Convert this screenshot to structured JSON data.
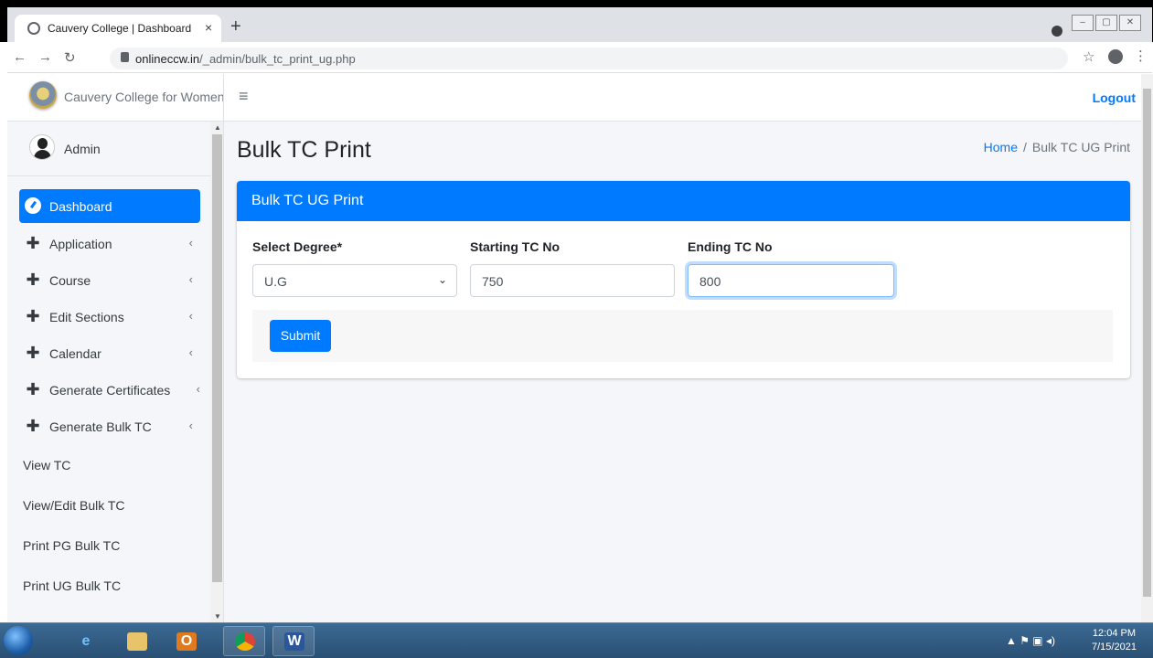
{
  "browser": {
    "tab_title": "Cauvery College | Dashboard",
    "tab_close": "×",
    "new_tab": "+",
    "url_host": "onlineccw.in",
    "url_path": "/_admin/bulk_tc_print_ug.php"
  },
  "sidebar": {
    "brand": "Cauvery College for Women",
    "user": "Admin",
    "items": [
      {
        "label": "Dashboard",
        "icon": "dashboard-gauge-icon",
        "active": true
      },
      {
        "label": "Application",
        "icon": "plus-icon",
        "chevron": "‹"
      },
      {
        "label": "Course",
        "icon": "plus-icon",
        "chevron": "‹"
      },
      {
        "label": "Edit Sections",
        "icon": "plus-icon",
        "chevron": "‹"
      },
      {
        "label": "Calendar",
        "icon": "plus-icon",
        "chevron": "‹"
      },
      {
        "label": "Generate Certificates",
        "icon": "plus-icon",
        "chevron": "‹"
      },
      {
        "label": "Generate Bulk TC",
        "icon": "plus-icon",
        "chevron": "‹"
      },
      {
        "label": "View TC"
      },
      {
        "label": "View/Edit Bulk TC"
      },
      {
        "label": "Print PG Bulk TC"
      },
      {
        "label": "Print UG Bulk TC"
      }
    ]
  },
  "header": {
    "logout": "Logout"
  },
  "page": {
    "title": "Bulk TC Print",
    "breadcrumb_home": "Home",
    "breadcrumb_sep": "/",
    "breadcrumb_current": "Bulk TC UG Print"
  },
  "form": {
    "card_title": "Bulk TC UG Print",
    "degree_label": "Select Degree*",
    "degree_value": "U.G",
    "start_label": "Starting TC No",
    "start_value": "750",
    "end_label": "Ending TC No",
    "end_value": "800",
    "submit": "Submit"
  },
  "taskbar": {
    "time": "12:04 PM",
    "date": "7/15/2021"
  },
  "colors": {
    "primary": "#007bff",
    "sidebar_bg": "#f4f6f9"
  }
}
